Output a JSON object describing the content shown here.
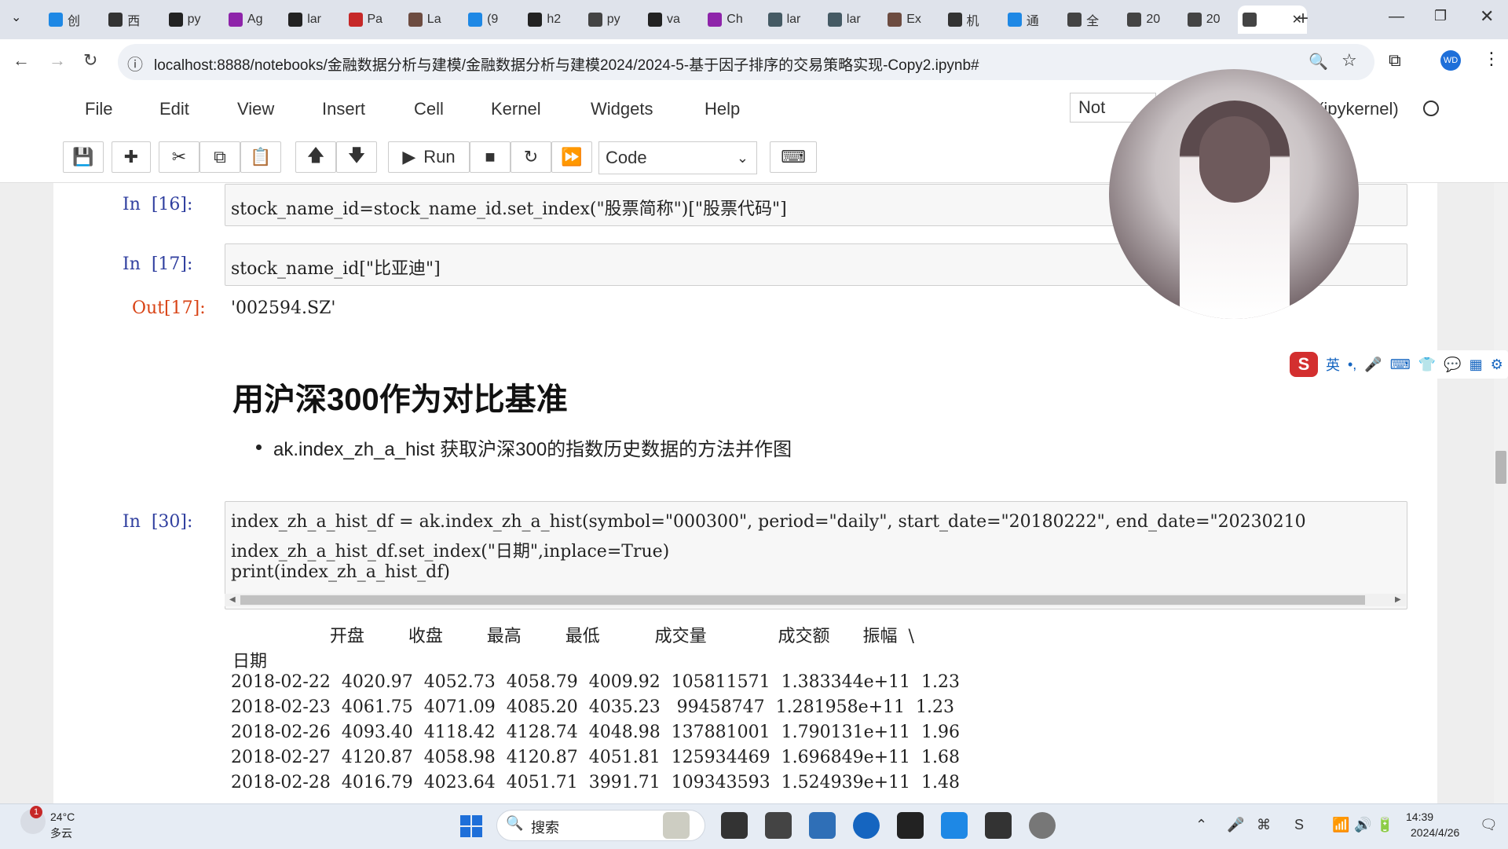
{
  "browser": {
    "tabs": [
      {
        "label": "创"
      },
      {
        "label": "西"
      },
      {
        "label": "py"
      },
      {
        "label": "Ag"
      },
      {
        "label": "lar"
      },
      {
        "label": "Pa"
      },
      {
        "label": "La"
      },
      {
        "label": "(9"
      },
      {
        "label": "h2"
      },
      {
        "label": "py"
      },
      {
        "label": "va"
      },
      {
        "label": "Ch"
      },
      {
        "label": "lar"
      },
      {
        "label": "lar"
      },
      {
        "label": "Ex"
      },
      {
        "label": "机"
      },
      {
        "label": "通"
      },
      {
        "label": "全"
      },
      {
        "label": "20"
      },
      {
        "label": "20"
      }
    ],
    "new_tab": "+",
    "url": "localhost:8888/notebooks/金融数据分析与建模/金融数据分析与建模2024/2024-5-基于因子排序的交易策略实现-Copy2.ipynb#",
    "profile_initials": "WD"
  },
  "jupyter": {
    "menu": [
      "File",
      "Edit",
      "View",
      "Insert",
      "Cell",
      "Kernel",
      "Widgets",
      "Help"
    ],
    "trusted": "Not Trusted",
    "kernel": "(ipykernel)",
    "run_label": "Run",
    "cell_type": "Code"
  },
  "cells": {
    "c16": {
      "prompt": "In  [16]:",
      "code": "stock_name_id=stock_name_id.set_index(\"股票简称\")[\"股票代码\"]"
    },
    "c17": {
      "prompt": "In  [17]:",
      "code": "stock_name_id[\"比亚迪\"]",
      "out_prompt": "Out[17]:",
      "output": "'002594.SZ'"
    },
    "markdown": {
      "heading": "用沪深300作为对比基准",
      "bullet": "ak.index_zh_a_hist 获取沪深300的指数历史数据的方法并作图"
    },
    "c30": {
      "prompt": "In  [30]:",
      "code_lines": [
        "index_zh_a_hist_df = ak.index_zh_a_hist(symbol=\"000300\", period=\"daily\", start_date=\"20180222\", end_date=\"20230210",
        "index_zh_a_hist_df.set_index(\"日期\",inplace=True)",
        "print(index_zh_a_hist_df)"
      ],
      "table": {
        "header": "                  开盘        收盘        最高        最低          成交量             成交额      振幅  \\",
        "index_name": "日期",
        "rows": [
          "2018-02-22  4020.97  4052.73  4058.79  4009.92  105811571  1.383344e+11  1.23",
          "2018-02-23  4061.75  4071.09  4085.20  4035.23   99458747  1.281958e+11  1.23",
          "2018-02-26  4093.40  4118.42  4128.74  4048.98  137881001  1.790131e+11  1.96",
          "2018-02-27  4120.87  4058.98  4120.87  4051.81  125934469  1.696849e+11  1.68",
          "2018-02-28  4016.79  4023.64  4051.71  3991.71  109343593  1.524939e+11  1.48"
        ]
      }
    }
  },
  "ime": {
    "lang": "英"
  },
  "taskbar": {
    "weather_temp": "24°C",
    "weather_desc": "多云",
    "weather_badge": "1",
    "search_placeholder": "搜索",
    "time": "14:39",
    "date": "2024/4/26"
  }
}
